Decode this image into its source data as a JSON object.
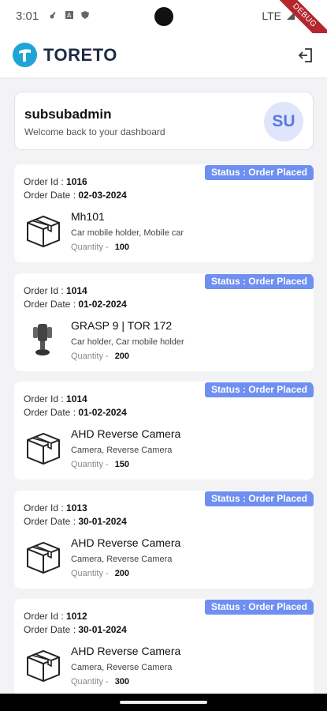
{
  "statusbar": {
    "time": "3:01",
    "network": "LTE",
    "debug": "DEBUG"
  },
  "app": {
    "logo_text": "TORETO"
  },
  "profile": {
    "name": "subsubadmin",
    "subtitle": "Welcome back to your dashboard",
    "avatar_initials": "SU"
  },
  "labels": {
    "order_id": "Order Id :",
    "order_date": "Order Date :",
    "quantity": "Quantity -"
  },
  "orders": [
    {
      "status": "Status : Order Placed",
      "id": "1016",
      "date": "02-03-2024",
      "product": "Mh101",
      "categories": "Car mobile holder,  Mobile car",
      "quantity": "100",
      "image": "box-icon"
    },
    {
      "status": "Status : Order Placed",
      "id": "1014",
      "date": "01-02-2024",
      "product": "GRASP 9 | TOR 172",
      "categories": "Car holder,  Car mobile holder",
      "quantity": "200",
      "image": "phone-holder-image"
    },
    {
      "status": "Status : Order Placed",
      "id": "1014",
      "date": "01-02-2024",
      "product": "AHD Reverse Camera",
      "categories": "Camera,  Reverse Camera",
      "quantity": "150",
      "image": "box-icon"
    },
    {
      "status": "Status : Order Placed",
      "id": "1013",
      "date": "30-01-2024",
      "product": "AHD Reverse Camera",
      "categories": "Camera,  Reverse Camera",
      "quantity": "200",
      "image": "box-icon"
    },
    {
      "status": "Status : Order Placed",
      "id": "1012",
      "date": "30-01-2024",
      "product": "AHD Reverse Camera",
      "categories": "Camera,  Reverse Camera",
      "quantity": "300",
      "image": "box-icon"
    }
  ],
  "colors": {
    "accent": "#6f8ff1",
    "brand": "#1ea5d8"
  }
}
